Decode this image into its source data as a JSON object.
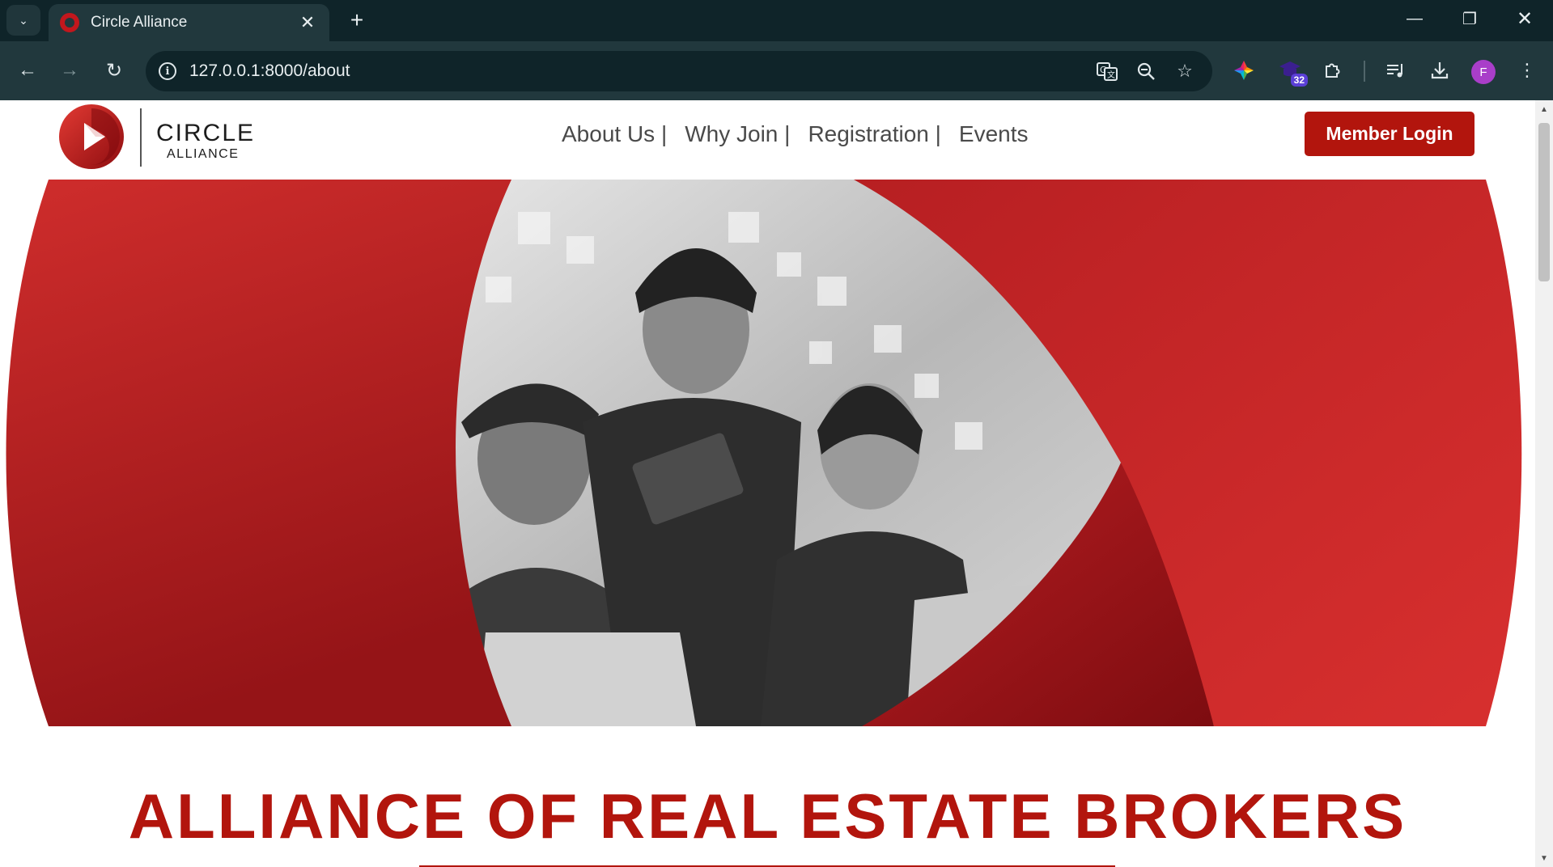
{
  "browser": {
    "tab_title": "Circle Alliance",
    "tab_close": "✕",
    "new_tab": "+",
    "url": "127.0.0.1:8000/about",
    "extension_badge": "32",
    "profile_initial": "F",
    "icons": [
      "tab-search-icon",
      "back-arrow-icon",
      "forward-arrow-icon",
      "reload-icon",
      "site-info-icon",
      "translate-icon",
      "zoom-icon",
      "bookmark-star-icon",
      "color-wheel-extension-icon",
      "extension-32-icon",
      "extensions-puzzle-icon",
      "media-control-icon",
      "download-icon",
      "menu-kebab-icon",
      "minimize-icon",
      "restore-icon",
      "close-window-icon"
    ]
  },
  "site": {
    "logo": {
      "line1": "CIRCLE",
      "line2": "ALLIANCE"
    },
    "nav": [
      {
        "label": "About Us |"
      },
      {
        "label": "Why Join |"
      },
      {
        "label": "Registration |"
      },
      {
        "label": "Events"
      }
    ],
    "login_label": "Member Login",
    "headline": "ALLIANCE OF REAL ESTATE BROKERS"
  },
  "colors": {
    "brand_red": "#b2150d",
    "chrome_dark": "#0f2429",
    "chrome_toolbar": "#21383d"
  }
}
